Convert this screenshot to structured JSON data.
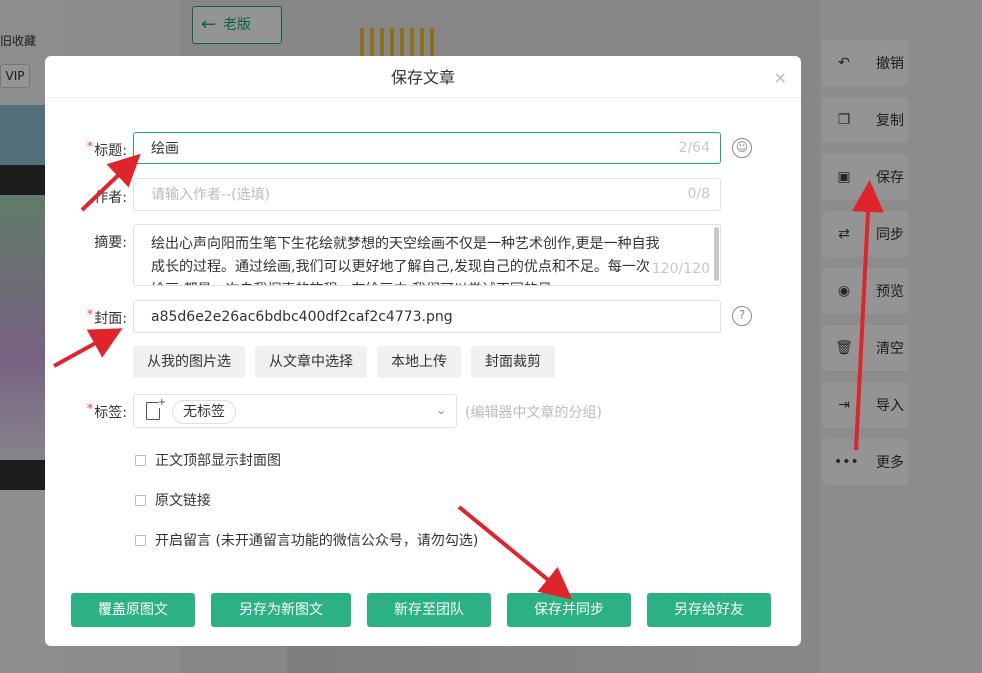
{
  "background": {
    "left_text": "旧收藏",
    "vip": "VIP",
    "old_version": "老版",
    "toolbar": [
      {
        "icon": "undo-icon",
        "glyph": "↶",
        "label": "撤销"
      },
      {
        "icon": "copy-icon",
        "glyph": "❐",
        "label": "复制"
      },
      {
        "icon": "save-icon",
        "glyph": "▣",
        "label": "保存"
      },
      {
        "icon": "sync-icon",
        "glyph": "⇄",
        "label": "同步"
      },
      {
        "icon": "eye-icon",
        "glyph": "◉",
        "label": "预览"
      },
      {
        "icon": "trash-icon",
        "glyph": "🗑",
        "label": "清空"
      },
      {
        "icon": "import-icon",
        "glyph": "⇥",
        "label": "导入"
      },
      {
        "icon": "more-icon",
        "glyph": "•••",
        "label": "更多"
      }
    ]
  },
  "dialog": {
    "title": "保存文章",
    "close": "×",
    "fields": {
      "title": {
        "label": "标题:",
        "value": "绘画",
        "count": "2/64"
      },
      "author": {
        "label": "作者:",
        "placeholder": "请输入作者--(选填)",
        "count": "0/8"
      },
      "summary": {
        "label": "摘要:",
        "value": "绘出心声向阳而生笔下生花绘就梦想的天空绘画不仅是一种艺术创作,更是一种自我成长的过程。通过绘画,我们可以更好地了解自己,发现自己的优点和不足。每一次绘画,都是一次自我探索的旅程。在绘画中,我们可以尝试不同的风",
        "count": "120/120"
      },
      "cover": {
        "label": "封面:",
        "value": "a85d6e2e26ac6bdbc400df2caf2c4773.png"
      },
      "tags": {
        "label": "标签:",
        "chip": "无标签",
        "hint": "(编辑器中文章的分组)"
      }
    },
    "cover_buttons": [
      "从我的图片选",
      "从文章中选择",
      "本地上传",
      "封面裁剪"
    ],
    "checkboxes": [
      "正文顶部显示封面图",
      "原文链接",
      "开启留言 (未开通留言功能的微信公众号，请勿勾选)"
    ],
    "footer_buttons": [
      "覆盖原图文",
      "另存为新图文",
      "新存至团队",
      "保存并同步",
      "另存给好友"
    ]
  },
  "colors": {
    "accent": "#2bb184",
    "arrow": "#e0242b",
    "required": "#e04848"
  }
}
